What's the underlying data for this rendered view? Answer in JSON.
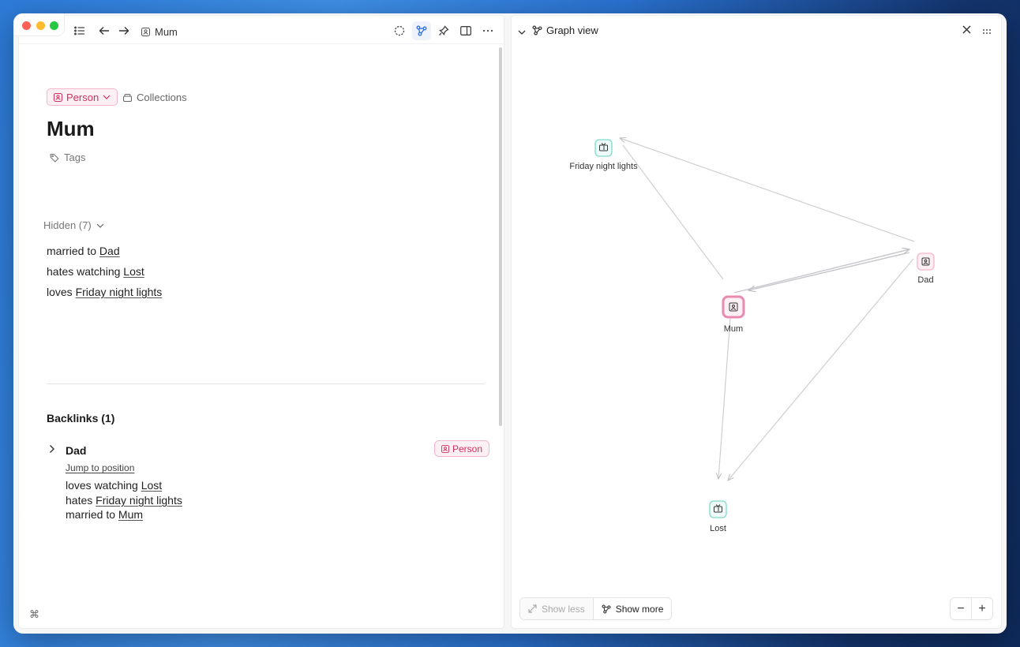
{
  "toolbar": {
    "breadcrumb": "Mum"
  },
  "page": {
    "type_label": "Person",
    "collections_label": "Collections",
    "title": "Mum",
    "tags_label": "Tags",
    "hidden_label": "Hidden (7)",
    "properties": [
      {
        "relation": "married to",
        "target": "Dad"
      },
      {
        "relation": "hates watching",
        "target": "Lost"
      },
      {
        "relation": "loves",
        "target": "Friday night lights"
      }
    ]
  },
  "backlinks": {
    "title": "Backlinks (1)",
    "items": [
      {
        "name": "Dad",
        "type_label": "Person",
        "jump_label": "Jump to position",
        "rows": [
          {
            "relation": "loves watching",
            "target": "Lost"
          },
          {
            "relation": "hates",
            "target": "Friday night lights"
          },
          {
            "relation": "married to",
            "target": "Mum"
          }
        ]
      }
    ]
  },
  "graph_panel": {
    "title": "Graph view",
    "show_less": "Show less",
    "show_more": "Show more",
    "zoom_out": "−",
    "zoom_in": "+",
    "nodes": [
      {
        "id": "fnl",
        "label": "Friday night lights",
        "kind": "show"
      },
      {
        "id": "dad",
        "label": "Dad",
        "kind": "person"
      },
      {
        "id": "mum",
        "label": "Mum",
        "kind": "person",
        "selected": true
      },
      {
        "id": "lost",
        "label": "Lost",
        "kind": "show"
      }
    ]
  },
  "colors": {
    "person_accent": "#d3305f",
    "person_bg": "#fdf0f4",
    "show_accent": "#52c9b6",
    "edge": "#cfcfd3"
  }
}
